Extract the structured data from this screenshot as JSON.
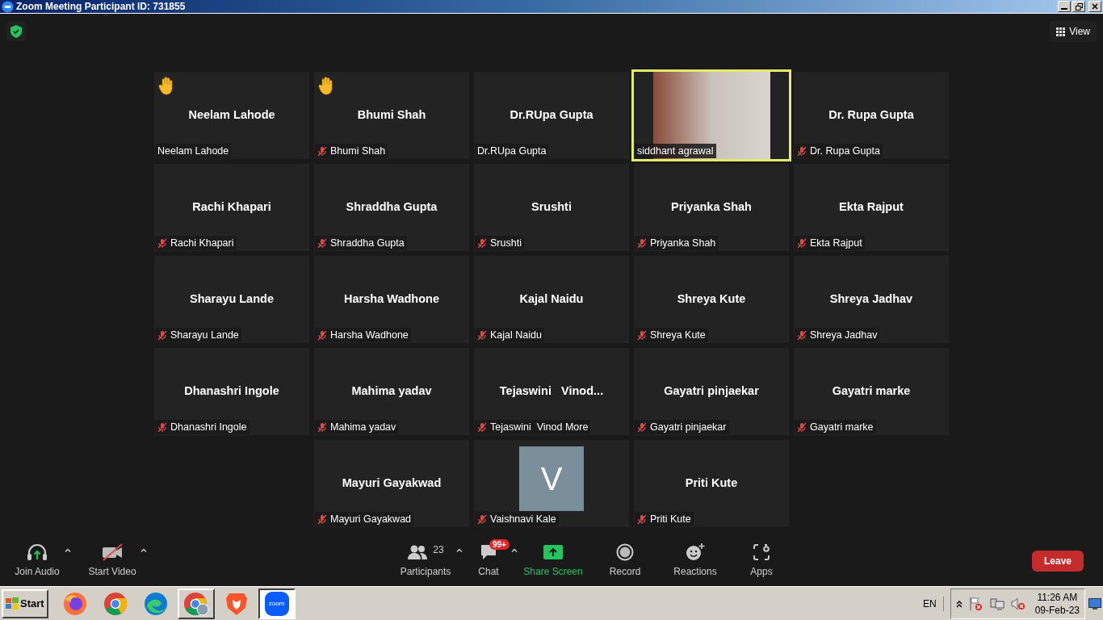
{
  "window": {
    "title": "Zoom Meeting Participant ID: 731855"
  },
  "view_button": "View",
  "tile_rows": [
    [
      {
        "kind": "name",
        "display_name": "Neelam Lahode",
        "label": "Neelam Lahode",
        "muted": false,
        "hand_raised": true,
        "speaking": false
      },
      {
        "kind": "name",
        "display_name": "Bhumi Shah",
        "label": "Bhumi Shah",
        "muted": true,
        "hand_raised": true,
        "speaking": false
      },
      {
        "kind": "name",
        "display_name": "Dr.RUpa Gupta",
        "label": "Dr.RUpa Gupta",
        "muted": false,
        "hand_raised": false,
        "speaking": false
      },
      {
        "kind": "video",
        "label": "siddhant agrawal",
        "muted": false,
        "hand_raised": false,
        "speaking": true
      },
      {
        "kind": "name",
        "display_name": "Dr. Rupa Gupta",
        "label": "Dr. Rupa Gupta",
        "muted": true,
        "hand_raised": false,
        "speaking": false
      }
    ],
    [
      {
        "kind": "name",
        "display_name": "Rachi Khapari",
        "label": "Rachi Khapari",
        "muted": true,
        "hand_raised": false,
        "speaking": false
      },
      {
        "kind": "name",
        "display_name": "Shraddha Gupta",
        "label": "Shraddha Gupta",
        "muted": true,
        "hand_raised": false,
        "speaking": false
      },
      {
        "kind": "name",
        "display_name": "Srushti",
        "label": "Srushti",
        "muted": true,
        "hand_raised": false,
        "speaking": false
      },
      {
        "kind": "name",
        "display_name": "Priyanka Shah",
        "label": "Priyanka Shah",
        "muted": true,
        "hand_raised": false,
        "speaking": false
      },
      {
        "kind": "name",
        "display_name": "Ekta Rajput",
        "label": "Ekta Rajput",
        "muted": true,
        "hand_raised": false,
        "speaking": false
      }
    ],
    [
      {
        "kind": "name",
        "display_name": "Sharayu Lande",
        "label": "Sharayu Lande",
        "muted": true,
        "hand_raised": false,
        "speaking": false
      },
      {
        "kind": "name",
        "display_name": "Harsha Wadhone",
        "label": "Harsha Wadhone",
        "muted": true,
        "hand_raised": false,
        "speaking": false
      },
      {
        "kind": "name",
        "display_name": "Kajal Naidu",
        "label": "Kajal Naidu",
        "muted": true,
        "hand_raised": false,
        "speaking": false
      },
      {
        "kind": "name",
        "display_name": "Shreya Kute",
        "label": "Shreya Kute",
        "muted": true,
        "hand_raised": false,
        "speaking": false
      },
      {
        "kind": "name",
        "display_name": "Shreya Jadhav",
        "label": "Shreya Jadhav",
        "muted": true,
        "hand_raised": false,
        "speaking": false
      }
    ],
    [
      {
        "kind": "name",
        "display_name": "Dhanashri Ingole",
        "label": "Dhanashri Ingole",
        "muted": true,
        "hand_raised": false,
        "speaking": false
      },
      {
        "kind": "name",
        "display_name": "Mahima yadav",
        "label": "Mahima yadav",
        "muted": true,
        "hand_raised": false,
        "speaking": false
      },
      {
        "kind": "name",
        "display_name": "Tejaswini   Vinod...",
        "label": "Tejaswini  Vinod More",
        "muted": true,
        "hand_raised": false,
        "speaking": false
      },
      {
        "kind": "name",
        "display_name": "Gayatri pinjaekar",
        "label": "Gayatri pinjaekar",
        "muted": true,
        "hand_raised": false,
        "speaking": false
      },
      {
        "kind": "name",
        "display_name": "Gayatri marke",
        "label": "Gayatri marke",
        "muted": true,
        "hand_raised": false,
        "speaking": false
      }
    ],
    [
      {
        "kind": "name",
        "display_name": "Mayuri Gayakwad",
        "label": "Mayuri Gayakwad",
        "muted": true,
        "hand_raised": false,
        "speaking": false
      },
      {
        "kind": "avatar",
        "initial": "V",
        "label": "Vaishnavi Kale",
        "muted": true,
        "hand_raised": false,
        "speaking": false
      },
      {
        "kind": "name",
        "display_name": "Priti Kute",
        "label": "Priti Kute",
        "muted": true,
        "hand_raised": false,
        "speaking": false
      }
    ]
  ],
  "toolbar": [
    {
      "kind": "audio",
      "label": "Join Audio",
      "menu": true
    },
    {
      "kind": "video",
      "label": "Start Video",
      "menu": true
    },
    {
      "kind": "participants",
      "label": "Participants",
      "count": "23",
      "menu": true
    },
    {
      "kind": "chat",
      "label": "Chat",
      "badge": "99+",
      "menu": true
    },
    {
      "kind": "share",
      "label": "Share Screen",
      "menu": false
    },
    {
      "kind": "record",
      "label": "Record",
      "menu": false
    },
    {
      "kind": "reactions",
      "label": "Reactions",
      "menu": false
    },
    {
      "kind": "apps",
      "label": "Apps",
      "menu": false
    }
  ],
  "leave_button": "Leave",
  "taskbar": {
    "start": "Start",
    "apps": [
      {
        "kind": "firefox",
        "open": false,
        "active": false
      },
      {
        "kind": "chrome",
        "open": false,
        "active": false
      },
      {
        "kind": "edge",
        "open": false,
        "active": false
      },
      {
        "kind": "chrome-profile",
        "open": true,
        "active": false
      },
      {
        "kind": "brave",
        "open": false,
        "active": false
      },
      {
        "kind": "zoom",
        "label": "zoom",
        "open": true,
        "active": true
      }
    ],
    "language": "EN",
    "time": "11:26 AM",
    "date": "09-Feb-23"
  }
}
